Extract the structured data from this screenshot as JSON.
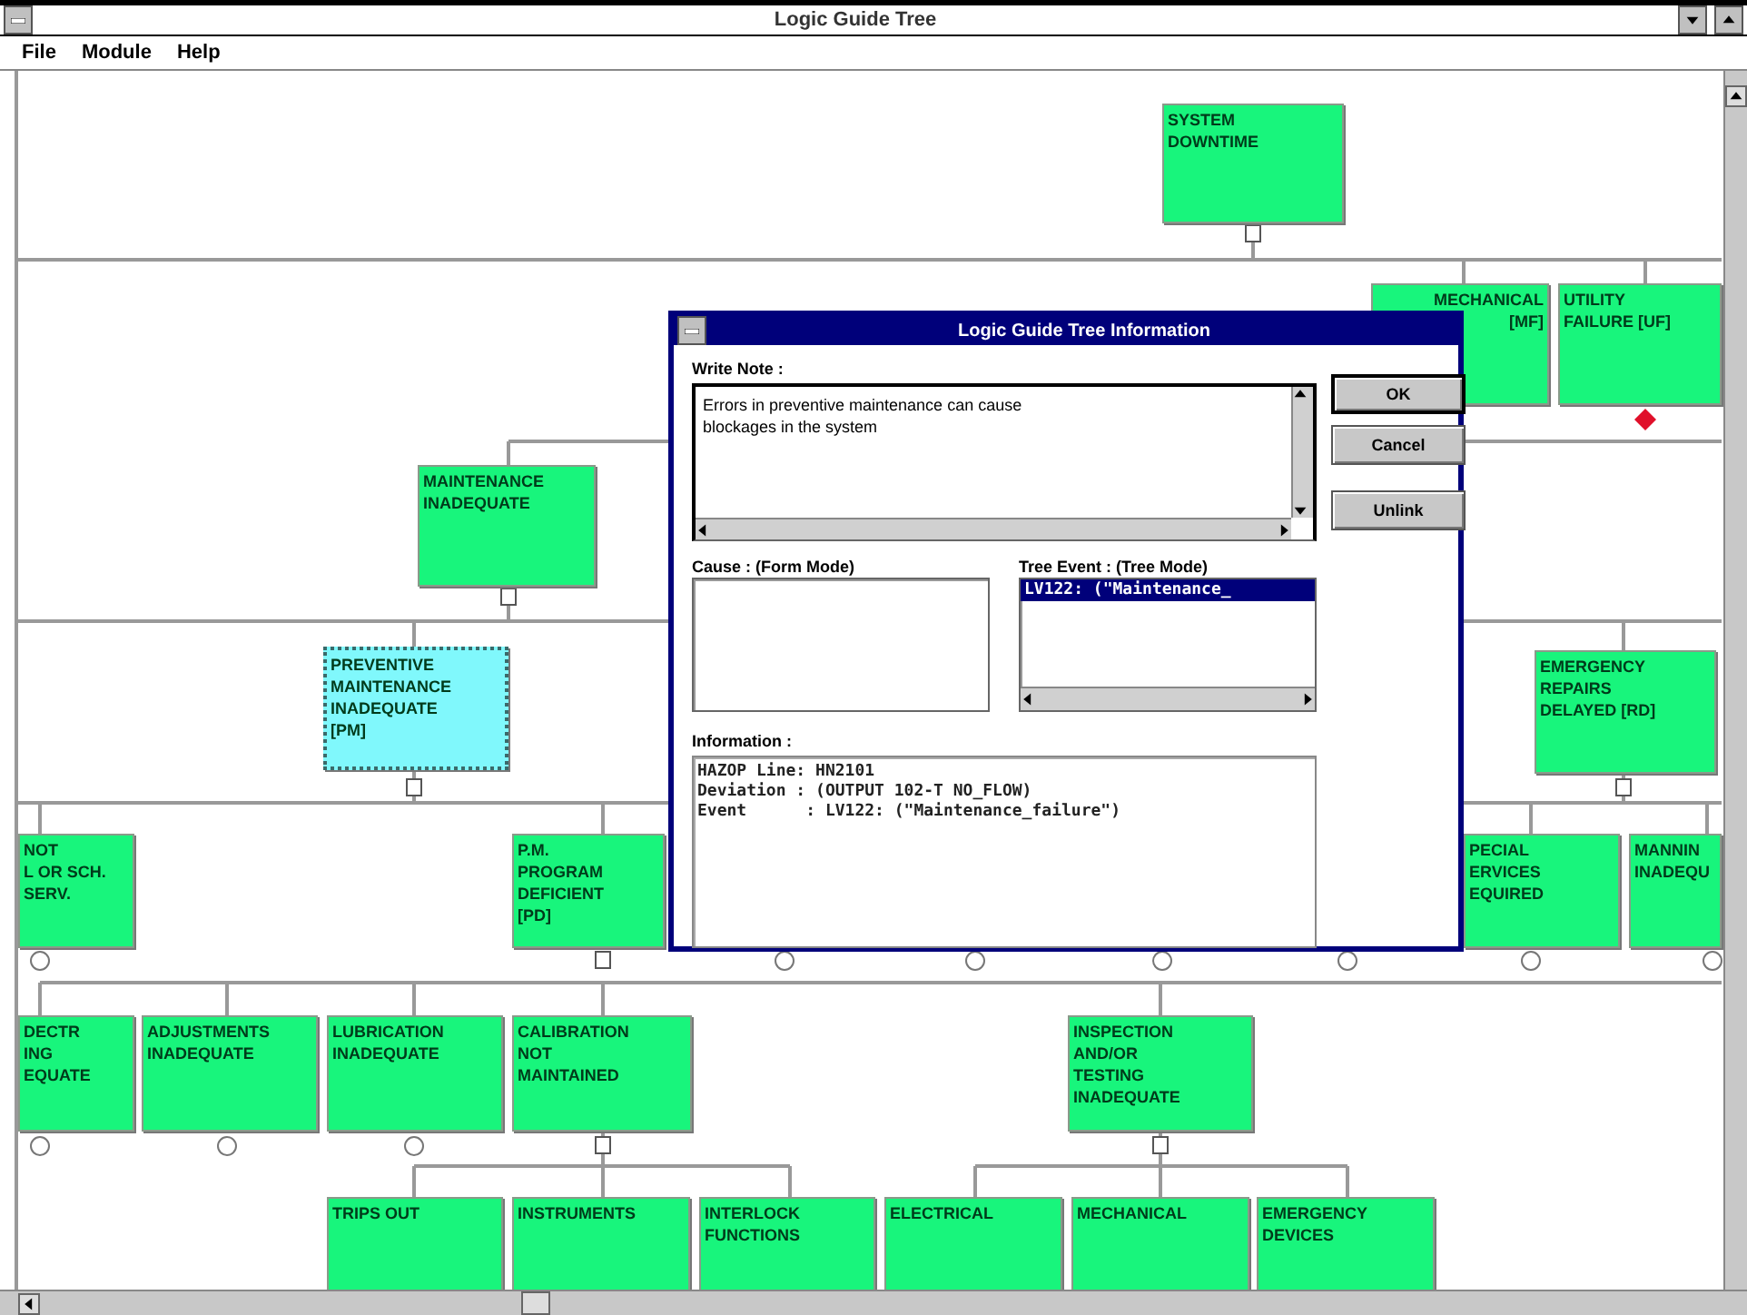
{
  "window": {
    "title": "Logic Guide Tree"
  },
  "menu": [
    {
      "label": "File"
    },
    {
      "label": "Module"
    },
    {
      "label": "Help"
    }
  ],
  "tree": {
    "nodes": [
      {
        "lines": [
          "SYSTEM",
          "DOWNTIME"
        ],
        "selected": false
      },
      {
        "lines": [
          "MECHANICAL",
          "[MF]"
        ],
        "selected": false
      },
      {
        "lines": [
          "UTILITY",
          "FAILURE [UF]"
        ],
        "selected": false
      },
      {
        "lines": [
          "MAINTENANCE",
          "INADEQUATE"
        ],
        "selected": false
      },
      {
        "lines": [
          "PREVENTIVE",
          "MAINTENANCE",
          "INADEQUATE",
          "[PM]"
        ],
        "selected": true
      },
      {
        "lines": [
          "EMERGENCY",
          "REPAIRS",
          "DELAYED [RD]"
        ],
        "selected": false
      },
      {
        "lines": [
          "NOT",
          "L OR SCH.",
          "SERV."
        ],
        "selected": false
      },
      {
        "lines": [
          "P.M.",
          "PROGRAM",
          "DEFICIENT",
          "[PD]"
        ],
        "selected": false
      },
      {
        "lines": [
          "PECIAL",
          "ERVICES",
          "EQUIRED"
        ],
        "selected": false
      },
      {
        "lines": [
          "MANNIN",
          "INADEQU"
        ],
        "selected": false
      },
      {
        "lines": [
          "DECTR",
          "ING",
          "EQUATE"
        ],
        "selected": false
      },
      {
        "lines": [
          "ADJUSTMENTS",
          "INADEQUATE"
        ],
        "selected": false
      },
      {
        "lines": [
          "LUBRICATION",
          "INADEQUATE"
        ],
        "selected": false
      },
      {
        "lines": [
          "CALIBRATION",
          "NOT",
          "MAINTAINED"
        ],
        "selected": false
      },
      {
        "lines": [
          "INSPECTION",
          "AND/OR",
          "TESTING",
          "INADEQUATE"
        ],
        "selected": false
      },
      {
        "lines": [
          "TRIPS OUT"
        ],
        "selected": false
      },
      {
        "lines": [
          "INSTRUMENTS"
        ],
        "selected": false
      },
      {
        "lines": [
          "INTERLOCK",
          "FUNCTIONS"
        ],
        "selected": false
      },
      {
        "lines": [
          "ELECTRICAL"
        ],
        "selected": false
      },
      {
        "lines": [
          "MECHANICAL"
        ],
        "selected": false
      },
      {
        "lines": [
          "EMERGENCY",
          "DEVICES"
        ],
        "selected": false
      }
    ]
  },
  "dialog": {
    "title": "Logic Guide Tree Information",
    "note": {
      "label": "Write Note :",
      "value": "Errors in preventive maintenance can cause\nblockages in the system"
    },
    "buttons": [
      {
        "label": "OK",
        "default": true
      },
      {
        "label": "Cancel",
        "default": false
      },
      {
        "label": "Unlink",
        "default": false
      }
    ],
    "cause": {
      "label": "Cause : (Form Mode)"
    },
    "tree_event": {
      "label": "Tree Event : (Tree Mode)",
      "items": [
        {
          "text": "LV122: (\"Maintenance_",
          "selected": true
        }
      ]
    },
    "information": {
      "label": "Information :",
      "lines": [
        "HAZOP Line: HN2101",
        "Deviation : (OUTPUT 102-T NO_FLOW)",
        "Event      : LV122: (\"Maintenance_failure\")"
      ]
    }
  }
}
